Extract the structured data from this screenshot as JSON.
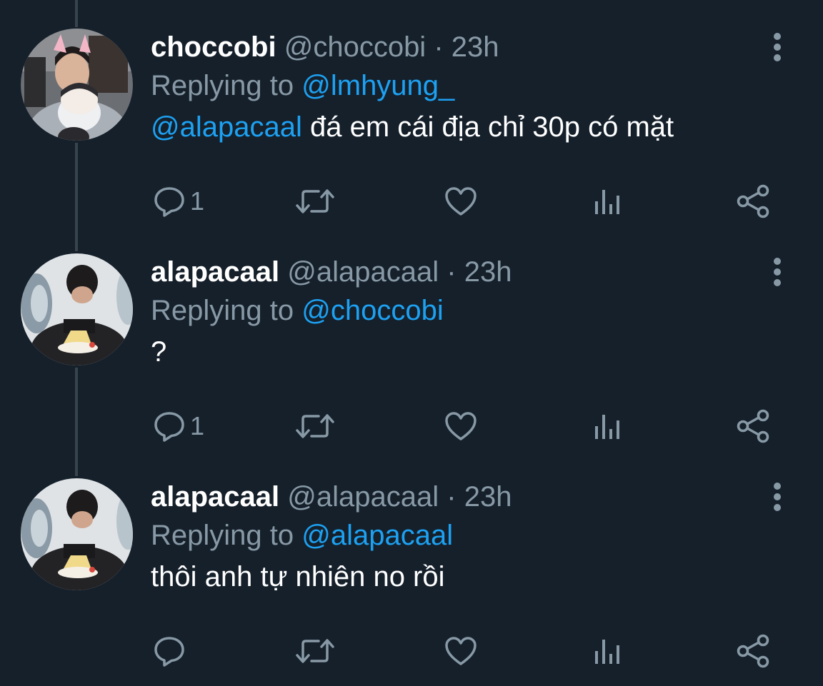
{
  "colors": {
    "background": "#15202b",
    "text_primary": "#ffffff",
    "text_secondary": "#8899a6",
    "accent": "#1da1f2",
    "thread_line": "#38444d"
  },
  "tweets": [
    {
      "display_name": "choccobi",
      "handle": "@choccobi",
      "separator": "·",
      "time": "23h",
      "replying_prefix": "Replying to",
      "replying_to": "@lmhyung_",
      "mention": "@alapacaal",
      "text": "đá em cái địa chỉ 30p có mặt",
      "reply_count": "1",
      "icons": [
        "reply-icon",
        "retweet-icon",
        "like-icon",
        "analytics-icon",
        "share-icon",
        "more-icon"
      ]
    },
    {
      "display_name": "alapacaal",
      "handle": "@alapacaal",
      "separator": "·",
      "time": "23h",
      "replying_prefix": "Replying to",
      "replying_to": "@choccobi",
      "mention": "",
      "text": "?",
      "reply_count": "1",
      "icons": [
        "reply-icon",
        "retweet-icon",
        "like-icon",
        "analytics-icon",
        "share-icon",
        "more-icon"
      ]
    },
    {
      "display_name": "alapacaal",
      "handle": "@alapacaal",
      "separator": "·",
      "time": "23h",
      "replying_prefix": "Replying to",
      "replying_to": "@alapacaal",
      "mention": "",
      "text": "thôi anh tự nhiên no rồi",
      "reply_count": "",
      "icons": [
        "reply-icon",
        "retweet-icon",
        "like-icon",
        "analytics-icon",
        "share-icon",
        "more-icon"
      ]
    }
  ]
}
